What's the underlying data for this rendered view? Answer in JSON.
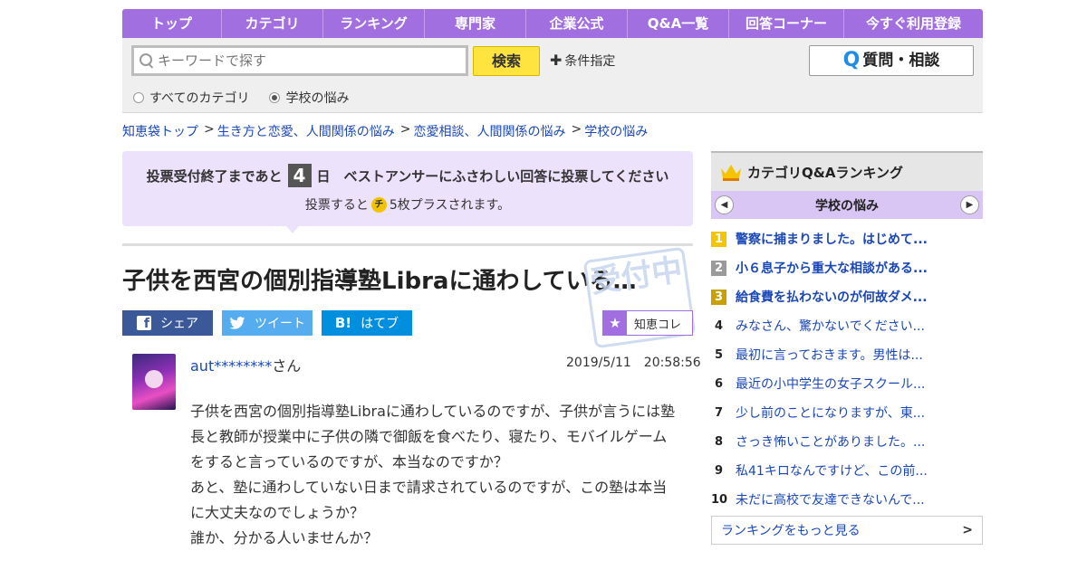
{
  "nav": [
    "トップ",
    "カテゴリ",
    "ランキング",
    "専門家",
    "企業公式",
    "Q&A一覧",
    "回答コーナー",
    "今すぐ利用登録"
  ],
  "search": {
    "placeholder": "キーワードで探す",
    "button": "検索",
    "condition": "条件指定",
    "ask_button": "質問・相談",
    "scope_all": "すべてのカテゴリ",
    "scope_current": "学校の悩み",
    "selected_scope": "学校の悩み"
  },
  "breadcrumb": [
    "知恵袋トップ",
    "生き方と恋愛、人間関係の悩み",
    "恋愛相談、人間関係の悩み",
    "学校の悩み"
  ],
  "vote": {
    "prefix": "投票受付終了まであと",
    "days": "4",
    "suffix": "日　ベストアンサーにふさわしい回答に投票してください",
    "note_prefix": "投票すると",
    "coin": "チ",
    "note_suffix": "5枚プラスされます。"
  },
  "question": {
    "title": "子供を西宮の個別指導塾Libraに通わしている…",
    "stamp": "受付中",
    "user_masked": "aut********",
    "user_suffix": "さん",
    "date": "2019/5/11　20:58:56",
    "body": [
      "子供を西宮の個別指導塾Libraに通わしているのですが、子供が言うには塾",
      "長と教師が授業中に子供の隣で御飯を食べたり、寝たり、モバイルゲーム",
      "をすると言っているのですが、本当なのですか？",
      "あと、塾に通わしていない日まで請求されているのですが、この塾は本当",
      "に大丈夫なのでしょうか？",
      "誰か、分かる人いませんか？"
    ]
  },
  "share": {
    "facebook": "シェア",
    "twitter": "ツイート",
    "hatena_icon": "B!",
    "hatena": "はてブ",
    "chie_kore": "知恵コレ"
  },
  "ranking": {
    "title": "カテゴリQ&Aランキング",
    "category": "学校の悩み",
    "items": [
      {
        "rank": "1",
        "title": "警察に捕まりました。はじめて..."
      },
      {
        "rank": "2",
        "title": "小６息子から重大な相談がある..."
      },
      {
        "rank": "3",
        "title": "給食費を払わないのが何故ダメ..."
      },
      {
        "rank": "4",
        "title": "みなさん、驚かないでください..."
      },
      {
        "rank": "5",
        "title": "最初に言っておきます。男性は..."
      },
      {
        "rank": "6",
        "title": "最近の小中学生の女子スクール..."
      },
      {
        "rank": "7",
        "title": "少し前のことになりますが、東..."
      },
      {
        "rank": "8",
        "title": "さっき怖いことがありました。..."
      },
      {
        "rank": "9",
        "title": "私41キロなんですけど、この前..."
      },
      {
        "rank": "10",
        "title": "未だに高校で友達できないんで..."
      }
    ],
    "more": "ランキングをもっと見る"
  },
  "colors": {
    "nav_purple": "#a26fe0",
    "vote_bg": "#ede2fb",
    "search_yellow": "#ffe33f",
    "link_blue": "#1a47b8",
    "rank_gold": "#f5c400",
    "rank_silver": "#9a9a9a",
    "rank_bronze": "#c8a000"
  },
  "icons": [
    "search-icon",
    "plus-icon",
    "q-icon",
    "radio-icon",
    "facebook-icon",
    "twitter-icon",
    "hatena-icon",
    "star-icon",
    "crown-icon",
    "chevron-left-icon",
    "chevron-right-icon",
    "coin-icon"
  ]
}
